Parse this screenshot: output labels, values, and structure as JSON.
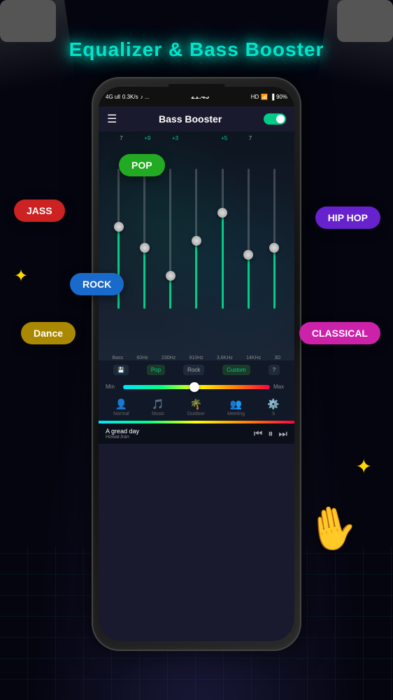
{
  "app": {
    "title": "Equalizer & Bass Booster"
  },
  "status_bar": {
    "signal": "4G ull",
    "speed": "0.3K/s",
    "icons": "♪ ...",
    "time": "21:45",
    "hd": "HD",
    "wifi": "90%",
    "battery": "▐"
  },
  "header": {
    "title": "Bass Booster",
    "toggle_state": "on"
  },
  "db_labels": [
    "+9",
    "+3",
    "",
    "+5",
    "7"
  ],
  "sliders": [
    {
      "label": "Bass",
      "fill_height": "60%",
      "thumb_pos": "38%"
    },
    {
      "label": "60Hz",
      "fill_height": "45%",
      "thumb_pos": "53%"
    },
    {
      "label": "230Hz",
      "fill_height": "25%",
      "thumb_pos": "73%"
    },
    {
      "label": "910Hz",
      "fill_height": "50%",
      "thumb_pos": "48%"
    },
    {
      "label": "3.6KHz",
      "fill_height": "70%",
      "thumb_pos": "28%"
    },
    {
      "label": "14KHz",
      "fill_height": "40%",
      "thumb_pos": "58%"
    },
    {
      "label": "3D",
      "fill_height": "45%",
      "thumb_pos": "53%"
    }
  ],
  "presets": [
    "Pop",
    "Rock",
    "Custom",
    "?"
  ],
  "bass_min": "Min",
  "bass_max": "Max",
  "nav_items": [
    {
      "icon": "👤",
      "label": "Normal"
    },
    {
      "icon": "🎵",
      "label": "Music"
    },
    {
      "icon": "🌴",
      "label": "Outdoor"
    },
    {
      "icon": "👥",
      "label": "Meeting"
    },
    {
      "icon": "...",
      "label": "S"
    }
  ],
  "player": {
    "song": "A gread day",
    "artist": "HowarJran"
  },
  "float_labels": {
    "jass": "JASS",
    "pop": "POP",
    "rock": "ROCK",
    "hiphop": "HIP HOP",
    "dance": "Dance",
    "classical": "CLASSICAL"
  },
  "sparkle_char": "✦"
}
